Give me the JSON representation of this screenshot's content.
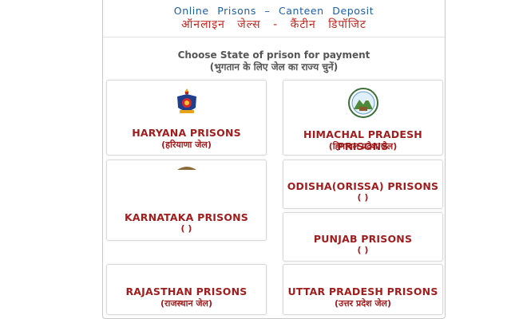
{
  "header": {
    "english": "Online Prisons – Canteen Deposit",
    "hindi": "ऑनलाइन जेल्स - कैंटीन डिपॉजिट"
  },
  "instruction": {
    "english": "Choose State of prison for payment",
    "hindi": "(भुगतान के लिए जेल का राज्य चुनें)"
  },
  "states": [
    {
      "name": "HARYANA PRISONS",
      "hindi": "(हरियाणा जेल)"
    },
    {
      "name": "HIMACHAL PRADESH PRISONS",
      "hindi": "(हिमाचल प्रदेश जेल)"
    },
    {
      "name": "KARNATAKA PRISONS",
      "hindi": "(                    )"
    },
    {
      "name": "ODISHA(ORISSA) PRISONS",
      "hindi": "(                          )"
    },
    {
      "name": "PUNJAB PRISONS",
      "hindi": "(                    )"
    },
    {
      "name": "RAJASTHAN PRISONS",
      "hindi": "(राजस्थान जेल)"
    },
    {
      "name": "UTTAR PRADESH PRISONS",
      "hindi": "(उत्तर प्रदेश जेल)"
    }
  ],
  "colors": {
    "header_english": "#1d5ea8",
    "header_hindi": "#c0261f",
    "state_text": "#a11d1d"
  }
}
